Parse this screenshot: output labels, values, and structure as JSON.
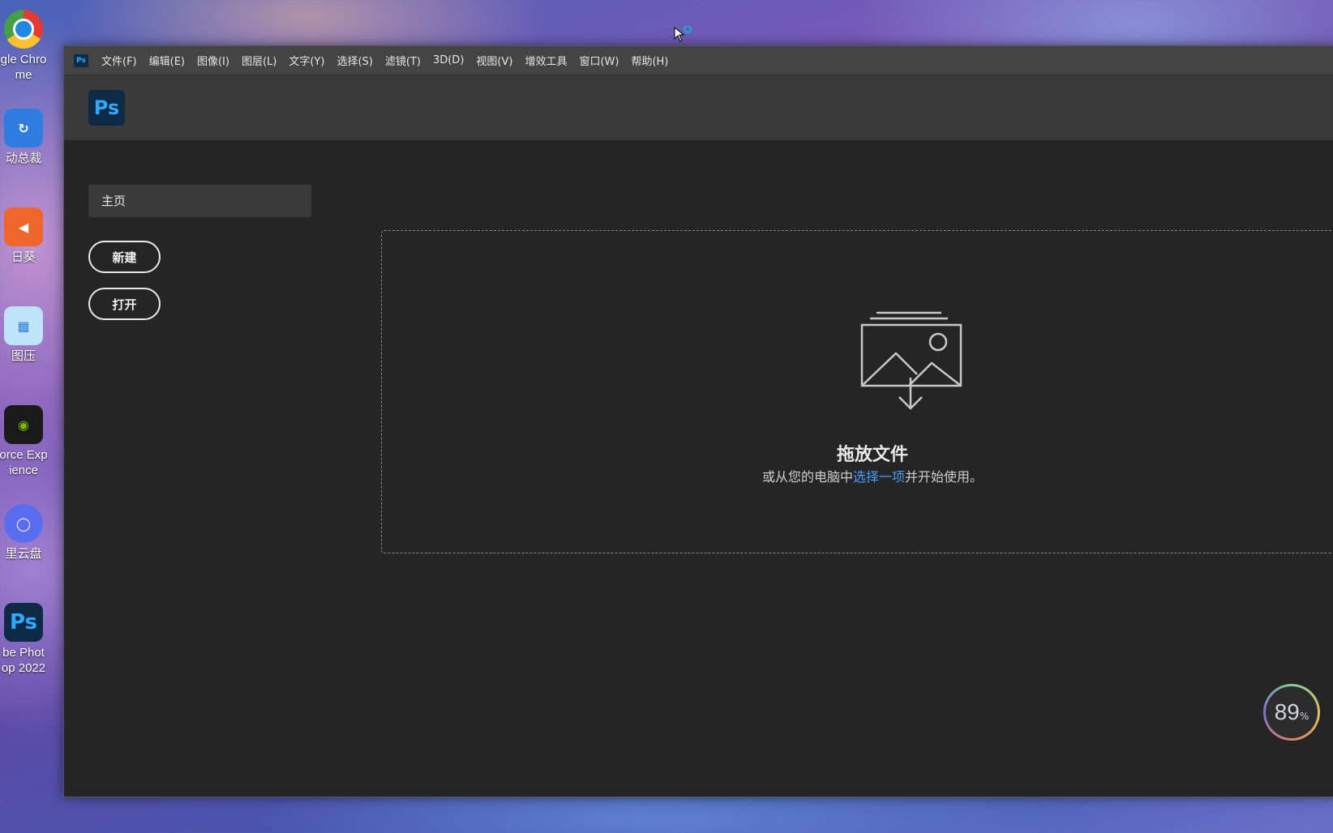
{
  "desktop": {
    "icons": [
      {
        "label": "gle Chro\nme",
        "glyph": "",
        "color": "#ffffff"
      },
      {
        "label": "动总裁",
        "glyph": "↻",
        "color": "#2f7de0"
      },
      {
        "label": "日葵",
        "glyph": "◀",
        "color": "#f0652a"
      },
      {
        "label": "图压",
        "glyph": "▦",
        "color": "#4fa8e0"
      },
      {
        "label": "orce Exp\nience",
        "glyph": "◉",
        "color": "#1a1a1a"
      },
      {
        "label": "里云盘",
        "glyph": "◯",
        "color": "#5a6cf0"
      },
      {
        "label": "be Phot\nop 2022",
        "glyph": "Ps",
        "color": "#0f2a47"
      }
    ]
  },
  "window": {
    "app_badge": "Ps",
    "menu": [
      "文件(F)",
      "编辑(E)",
      "图像(I)",
      "图层(L)",
      "文字(Y)",
      "选择(S)",
      "滤镜(T)",
      "3D(D)",
      "视图(V)",
      "增效工具",
      "窗口(W)",
      "帮助(H)"
    ],
    "logo": "Ps"
  },
  "home": {
    "tab_label": "主页",
    "new_button": "新建",
    "open_button": "打开"
  },
  "dropzone": {
    "title": "拖放文件",
    "sub_before": "或从您的电脑中",
    "sub_link": "选择一项",
    "sub_after": "并开始使用。"
  },
  "perf_widget": {
    "value": "89",
    "unit": "%"
  }
}
